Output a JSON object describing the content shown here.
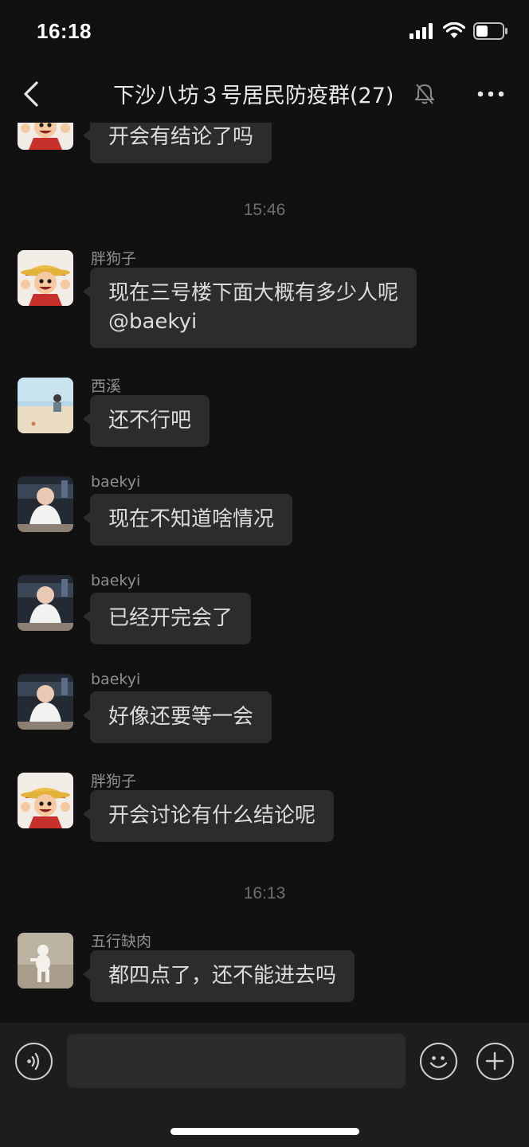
{
  "status_bar": {
    "time": "16:18",
    "icons": [
      "cellular-signal-icon",
      "wifi-icon",
      "battery-icon"
    ]
  },
  "nav": {
    "back_icon": "chevron-left-icon",
    "title": "下沙八坊３号居民防疫群(27)",
    "mute_icon": "muted-bell-icon",
    "more_icon": "more-dots-icon"
  },
  "chat": {
    "timestamps": [
      "15:46",
      "16:13"
    ],
    "messages": [
      {
        "sender": "",
        "text": "开会有结论了吗",
        "avatar": "luffy-avatar"
      },
      {
        "sender": "胖狗子",
        "text": "现在三号楼下面大概有多少人呢\n@baekyi",
        "avatar": "luffy-avatar"
      },
      {
        "sender": "西溪",
        "text": "还不行吧",
        "avatar": "beach-avatar"
      },
      {
        "sender": "baekyi",
        "text": "现在不知道啥情况",
        "avatar": "baby-avatar"
      },
      {
        "sender": "baekyi",
        "text": "已经开完会了",
        "avatar": "baby-avatar"
      },
      {
        "sender": "baekyi",
        "text": "好像还要等一会",
        "avatar": "baby-avatar"
      },
      {
        "sender": "胖狗子",
        "text": "开会讨论有什么结论呢",
        "avatar": "luffy-avatar"
      },
      {
        "sender": "五行缺肉",
        "text": "都四点了，还不能进去吗",
        "avatar": "sand-figure-avatar"
      }
    ]
  },
  "input_bar": {
    "voice_icon": "voice-icon",
    "input_value": "",
    "emoji_icon": "emoji-icon",
    "plus_icon": "plus-icon"
  },
  "colors": {
    "background": "#111111",
    "bubble": "#2c2c2c",
    "input_bar": "#1d1d1d"
  }
}
